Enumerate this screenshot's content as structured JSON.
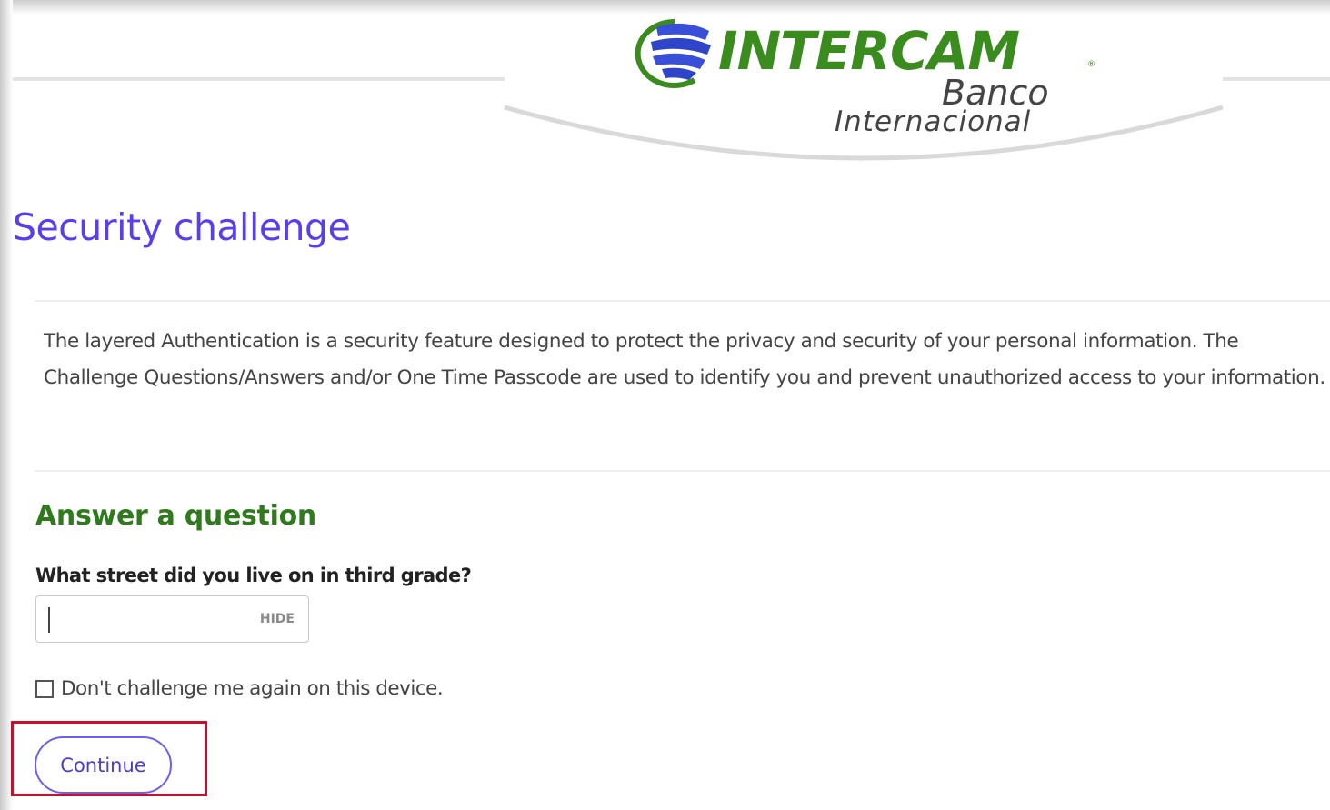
{
  "header": {
    "logo_word": "INTERCAM",
    "logo_registered": "®",
    "logo_line2": "Banco",
    "logo_line3": "Internacional",
    "logo_globe_icon": "intercam-globe-icon"
  },
  "colors": {
    "title_purple": "#5b3cf0",
    "logo_green": "#3a8c1e",
    "heading_green": "#2f7a1c",
    "button_border": "#6b5ff0",
    "highlight_red": "#c8102e"
  },
  "page": {
    "title": "Security challenge",
    "intro": "The layered Authentication is a security feature designed to protect the privacy and security of your personal information. The Challenge Questions/Answers and/or One Time Passcode are used to identify you and prevent unauthorized access to your information."
  },
  "challenge": {
    "heading": "Answer a question",
    "question": "What street did you live on in third grade?",
    "answer_value": "",
    "hide_label": "HIDE",
    "remember_label": "Don't challenge me again on this device.",
    "remember_checked": false
  },
  "actions": {
    "continue_label": "Continue"
  }
}
